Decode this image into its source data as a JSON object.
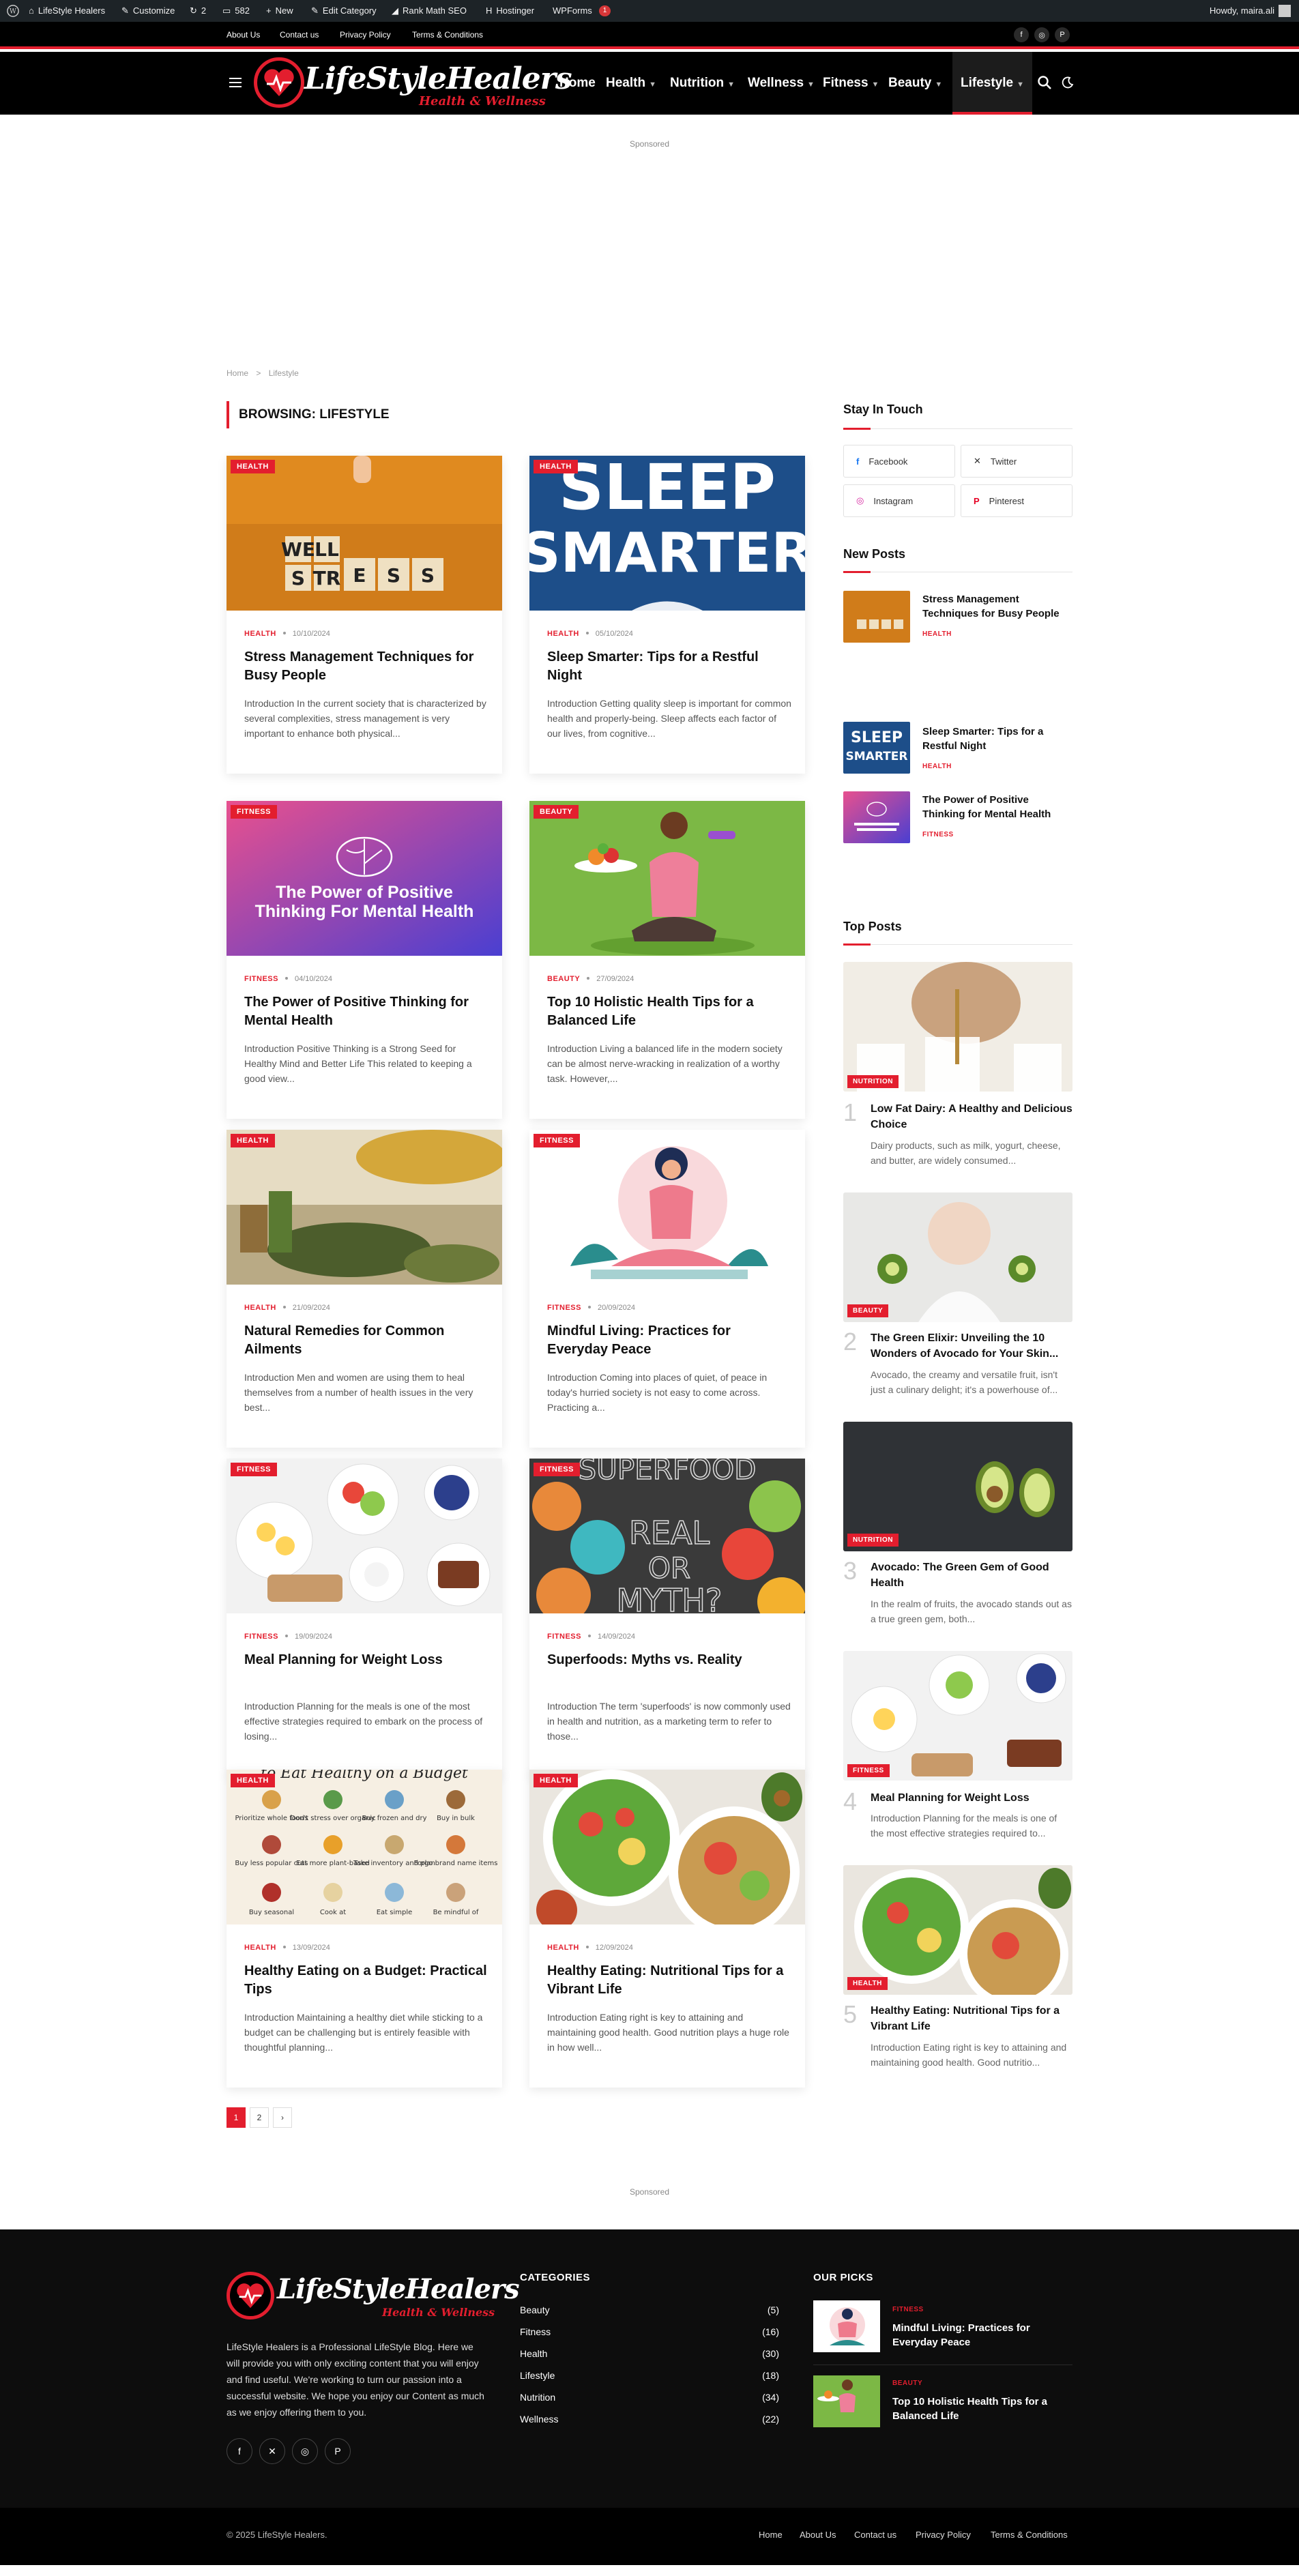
{
  "admin_bar": {
    "site": "LifeStyle Healers",
    "customize": "Customize",
    "updates": "2",
    "comments": "582",
    "new": "New",
    "edit": "Edit Category",
    "rankmath": "Rank Math SEO",
    "hostinger": "Hostinger",
    "wpforms": "WPForms",
    "wpforms_badge": "1",
    "howdy": "Howdy, maira.ali"
  },
  "top_links": [
    "About Us",
    "Contact us",
    "Privacy Policy",
    "Terms & Conditions"
  ],
  "social_top": [
    "f",
    "◎",
    "P"
  ],
  "logo": {
    "name": "LifeStyleHealers",
    "tagline": "Health & Wellness"
  },
  "nav": [
    {
      "label": "Home"
    },
    {
      "label": "Health"
    },
    {
      "label": "Nutrition"
    },
    {
      "label": "Wellness"
    },
    {
      "label": "Fitness"
    },
    {
      "label": "Beauty"
    },
    {
      "label": "Lifestyle"
    }
  ],
  "sponsored": "Sponsored",
  "breadcrumb": {
    "home": "Home",
    "sep": ">",
    "current": "Lifestyle"
  },
  "archive_heading": "BROWSING: LIFESTYLE",
  "posts": [
    {
      "cat": "HEALTH",
      "date": "10/10/2024",
      "title": "Stress Management Techniques for Busy People",
      "excerpt": "Introduction In the current society that is characterized by several complexities, stress management is very important to enhance both physical..."
    },
    {
      "cat": "HEALTH",
      "date": "05/10/2024",
      "title": "Sleep Smarter: Tips for a Restful Night",
      "excerpt": "Introduction Getting quality sleep is important for common health and properly-being. Sleep affects each factor of our lives, from cognitive..."
    },
    {
      "cat": "FITNESS",
      "date": "04/10/2024",
      "title": "The Power of Positive Thinking for Mental Health",
      "excerpt": "Introduction Positive Thinking is a Strong Seed for Healthy Mind and Better Life This related to keeping a good view..."
    },
    {
      "cat": "BEAUTY",
      "date": "27/09/2024",
      "title": "Top 10 Holistic Health Tips for a Balanced Life",
      "excerpt": "Introduction Living a balanced life in the modern society can be almost nerve-wracking in realization of a worthy task. However,..."
    },
    {
      "cat": "HEALTH",
      "date": "21/09/2024",
      "title": "Natural Remedies for Common Ailments",
      "excerpt": "Introduction Men and women are using them to heal themselves from a number of health issues in the very best..."
    },
    {
      "cat": "FITNESS",
      "date": "20/09/2024",
      "title": "Mindful Living: Practices for Everyday Peace",
      "excerpt": "Introduction Coming into places of quiet, of peace in today's hurried society is not easy to come across. Practicing a..."
    },
    {
      "cat": "FITNESS",
      "date": "19/09/2024",
      "title": "Meal Planning for Weight Loss",
      "excerpt": "Introduction Planning for the meals is one of the most effective strategies required to embark on the process of losing..."
    },
    {
      "cat": "FITNESS",
      "date": "14/09/2024",
      "title": "Superfoods: Myths vs. Reality",
      "excerpt": "Introduction The term 'superfoods' is now commonly used in health and nutrition, as a marketing term to refer to those..."
    },
    {
      "cat": "HEALTH",
      "date": "13/09/2024",
      "title": "Healthy Eating on a Budget: Practical Tips",
      "excerpt": "Introduction Maintaining a healthy diet while sticking to a budget can be challenging but is entirely feasible with thoughtful planning..."
    },
    {
      "cat": "HEALTH",
      "date": "12/09/2024",
      "title": "Healthy Eating: Nutritional Tips for a Vibrant Life",
      "excerpt": "Introduction Eating right is key to attaining and maintaining good health. Good nutrition plays a huge role in how well..."
    }
  ],
  "image_text": {
    "stress": [
      "WE",
      "LL",
      "S",
      "TR",
      "E",
      "S",
      "S"
    ],
    "sleep": [
      "SLEEP",
      "SMARTER"
    ],
    "positive": "The Power of Positive Thinking For Mental Health",
    "superfood": [
      "SUPERFOOD",
      "REAL",
      "OR",
      "MYTH?"
    ],
    "budget_top": "to Eat Healthy on a Budget",
    "budget_items": [
      "Prioritize whole foods",
      "Don't stress over organic",
      "Buy frozen and dry",
      "Buy in bulk",
      "Buy less popular cuts",
      "Eat more plant-based",
      "Take inventory and plan",
      "Forgo brand name items",
      "Buy seasonal",
      "Cook at",
      "Eat simple",
      "Be mindful of"
    ]
  },
  "pagination": {
    "pages": [
      "1",
      "2"
    ],
    "next": "›"
  },
  "sidebar": {
    "stay_title": "Stay In Touch",
    "socials": [
      "Facebook",
      "Twitter",
      "Instagram",
      "Pinterest"
    ],
    "new_posts_title": "New Posts",
    "new_posts": [
      {
        "title": "Stress Management Techniques for Busy People",
        "cat": "HEALTH"
      },
      {
        "title": "Sleep Smarter: Tips for a Restful Night",
        "cat": "HEALTH"
      },
      {
        "title": "The Power of Positive Thinking for Mental Health",
        "cat": "FITNESS"
      }
    ],
    "top_posts_title": "Top Posts",
    "top_posts": [
      {
        "num": "1",
        "cat": "NUTRITION",
        "title": "Low Fat Dairy: A Healthy and Delicious Choice",
        "excerpt": "Dairy products, such as milk, yogurt, cheese, and butter, are widely consumed..."
      },
      {
        "num": "2",
        "cat": "BEAUTY",
        "title": "The Green Elixir: Unveiling the 10 Wonders of Avocado for Your Skin...",
        "excerpt": "Avocado, the creamy and versatile fruit, isn't just a culinary delight; it's a powerhouse of..."
      },
      {
        "num": "3",
        "cat": "NUTRITION",
        "title": "Avocado: The Green Gem of Good Health",
        "excerpt": "In the realm of fruits, the avocado stands out as a true green gem, both..."
      },
      {
        "num": "4",
        "cat": "FITNESS",
        "title": "Meal Planning for Weight Loss",
        "excerpt": "Introduction Planning for the meals is one of the most effective strategies required to..."
      },
      {
        "num": "5",
        "cat": "HEALTH",
        "title": "Healthy Eating: Nutritional Tips for a Vibrant Life",
        "excerpt": "Introduction Eating right is key to attaining and maintaining good health. Good nutritio..."
      }
    ]
  },
  "footer": {
    "about": "LifeStyle Healers is a Professional LifeStyle Blog. Here we will provide you with only exciting content that you will enjoy and find useful. We're working to turn our passion into a successful website. We hope you enjoy our Content as much as we enjoy offering them to you.",
    "categories_title": "CATEGORIES",
    "categories": [
      {
        "name": "Beauty",
        "count": "(5)"
      },
      {
        "name": "Fitness",
        "count": "(16)"
      },
      {
        "name": "Health",
        "count": "(30)"
      },
      {
        "name": "Lifestyle",
        "count": "(18)"
      },
      {
        "name": "Nutrition",
        "count": "(34)"
      },
      {
        "name": "Wellness",
        "count": "(22)"
      }
    ],
    "picks_title": "OUR PICKS",
    "picks": [
      {
        "cat": "FITNESS",
        "title": "Mindful Living: Practices for Everyday Peace"
      },
      {
        "cat": "BEAUTY",
        "title": "Top 10 Holistic Health Tips for a Balanced Life"
      }
    ],
    "social": [
      "f",
      "✕",
      "◎",
      "P"
    ]
  },
  "copyright": "© 2025 LifeStyle Healers.",
  "bottom_links": [
    "Home",
    "About Us",
    "Contact us",
    "Privacy Policy",
    "Terms & Conditions"
  ],
  "colors": {
    "accent": "#e31e2e",
    "dark": "#000000"
  }
}
